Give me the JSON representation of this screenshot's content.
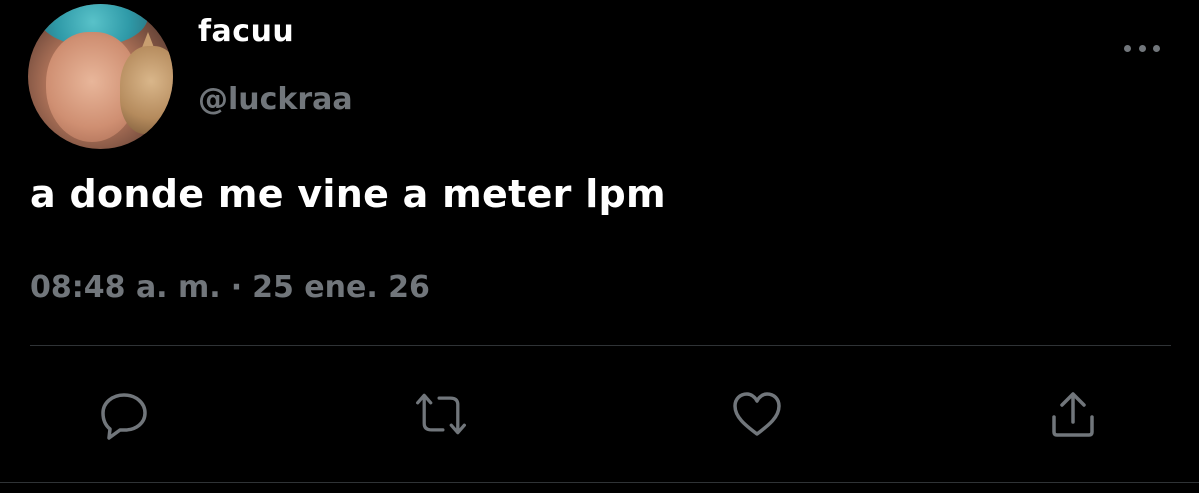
{
  "tweet": {
    "author": {
      "display_name": "facuu",
      "handle": "@luckraa",
      "avatar": "profile-photo"
    },
    "text": "a donde me vine a meter lpm",
    "time": "08:48 a. m.",
    "separator": "·",
    "date": "25 ene. 26"
  },
  "actions": {
    "reply": "reply-icon",
    "retweet": "retweet-icon",
    "like": "heart-icon",
    "share": "share-icon"
  },
  "more": "more-options-icon",
  "colors": {
    "background": "#000000",
    "primary_text": "#ffffff",
    "secondary_text": "#71767b",
    "divider": "#2f3336"
  }
}
